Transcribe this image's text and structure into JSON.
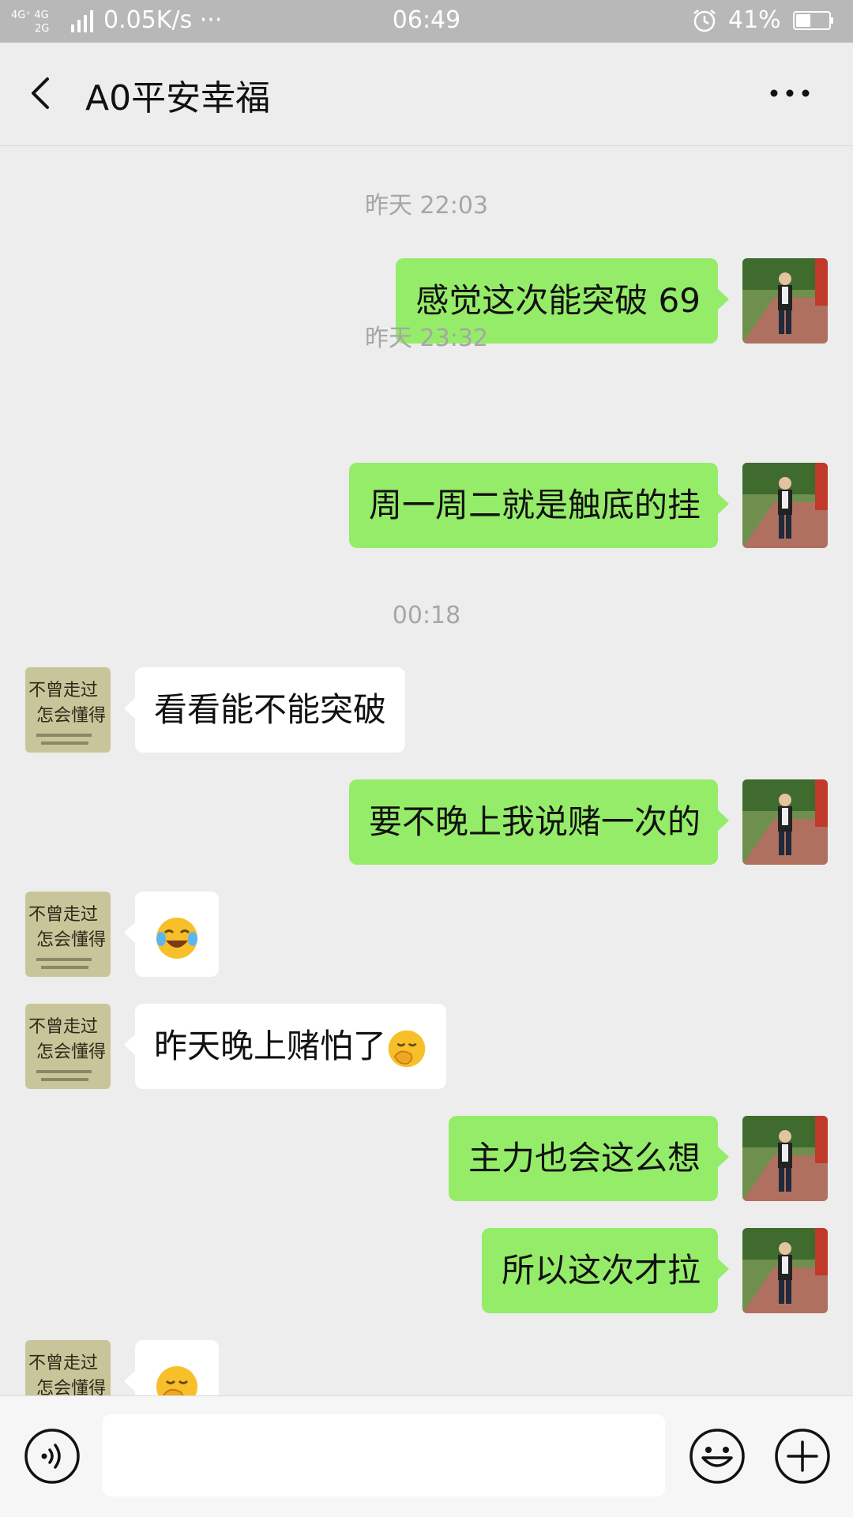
{
  "status_bar": {
    "network_top": "4G⁺ 4G",
    "network_bottom": "2G",
    "speed": "0.05K/s ···",
    "time": "06:49",
    "battery": "41%"
  },
  "header": {
    "title": "A0平安幸福"
  },
  "messages": [
    {
      "type": "time",
      "text": "昨天 22:03"
    },
    {
      "type": "me",
      "text": "感觉这次能突破 69"
    },
    {
      "type": "time",
      "text": "昨天 23:32"
    },
    {
      "type": "me",
      "text": "周一周二就是触底的挂"
    },
    {
      "type": "time",
      "text": "00:18"
    },
    {
      "type": "other",
      "text": "看看能不能突破"
    },
    {
      "type": "me",
      "text": "要不晚上我说赌一次的"
    },
    {
      "type": "other",
      "text": "",
      "emoji": "laugh-cry-emoji"
    },
    {
      "type": "other",
      "text": "昨天晚上赌怕了",
      "emoji": "hand-over-mouth-emoji"
    },
    {
      "type": "me",
      "text": "主力也会这么想"
    },
    {
      "type": "me",
      "text": "所以这次才拉"
    },
    {
      "type": "other",
      "text": "",
      "emoji": "hand-over-mouth-emoji"
    }
  ],
  "contact_avatar_text": [
    "不曾走过",
    "怎会懂得"
  ],
  "input": {
    "value": "",
    "placeholder": ""
  },
  "icons": {
    "back": "chevron-left-icon",
    "more": "more-dots-icon",
    "voice": "voice-icon",
    "emoji": "emoji-icon",
    "plus": "plus-icon"
  },
  "colors": {
    "my_bubble": "#95ec69",
    "other_bubble": "#ffffff",
    "background": "#ededed",
    "status_bar": "#b8b8b8"
  }
}
